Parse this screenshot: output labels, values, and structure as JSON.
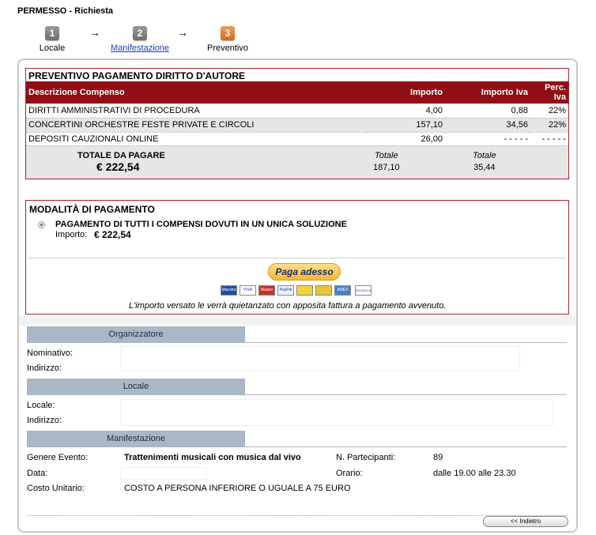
{
  "page": {
    "title": "PERMESSO - Richiesta"
  },
  "steps": [
    {
      "number": "1",
      "label": "Locale"
    },
    {
      "number": "2",
      "label": "Manifestazione"
    },
    {
      "number": "3",
      "label": "Preventivo"
    }
  ],
  "step_arrow": "→",
  "quote": {
    "title": "PREVENTIVO PAGAMENTO DIRITTO D'AUTORE",
    "headers": [
      "Descrizione Compenso",
      "Importo",
      "Importo Iva",
      "Perc. Iva"
    ],
    "rows": [
      [
        "DIRITTI AMMINISTRATIVI DI PROCEDURA",
        "4,00",
        "0,88",
        "22%"
      ],
      [
        "CONCERTINI ORCHESTRE FESTE PRIVATE E CIRCOLI",
        "157,10",
        "34,56",
        "22%"
      ],
      [
        "DEPOSITI CAUZIONALI ONLINE",
        "26,00",
        "- - - - -",
        "- - - - -"
      ]
    ],
    "total_label": "TOTALE DA PAGARE",
    "total_amount": "€ 222,54",
    "totale_caption": "Totale",
    "totale_importo": "187,10",
    "totale_iva": "35,44"
  },
  "payment": {
    "title": "MODALITÀ DI PAGAMENTO",
    "option_label": "PAGAMENTO DI TUTTI I COMPENSI DOVUTI IN UN UNICA SOLUZIONE",
    "importo_label": "Importo:",
    "importo_value": "€ 222,54",
    "pay_button": "Paga adesso",
    "cards": [
      "Maestro",
      "VISA",
      "PayPal",
      "Master",
      "",
      "",
      "AMEX",
      "RICARICA PAYPAL"
    ],
    "note": "L'importo versato le verrà quietanzato con apposita fattura a pagamento avvenuto."
  },
  "organizzatore": {
    "header": "Organizzatore",
    "nominativo_label": "Nominativo:",
    "indirizzo_label": "Indirizzo:"
  },
  "locale": {
    "header": "Locale",
    "locale_label": "Locale:",
    "indirizzo_label": "Indirizzo:"
  },
  "manifestazione": {
    "header": "Manifestazione",
    "genere_label": "Genere Evento:",
    "genere_value": "Trattenimenti musicali con musica dal vivo",
    "partecipanti_label": "N. Partecipanti:",
    "partecipanti_value": "89",
    "data_label": "Data:",
    "orario_label": "Orario:",
    "orario_value": "dalle 19.00 alle 23.30",
    "costo_label": "Costo Unitario:",
    "costo_value": "COSTO A PERSONA INFERIORE O UGUALE A 75 EURO"
  },
  "back_button": "<< Indietro",
  "colors": {
    "header_red": "#8f0f15",
    "border_red": "#a8242d",
    "section_blue": "#a9b7c7",
    "step_orange": "#e07a2c"
  }
}
